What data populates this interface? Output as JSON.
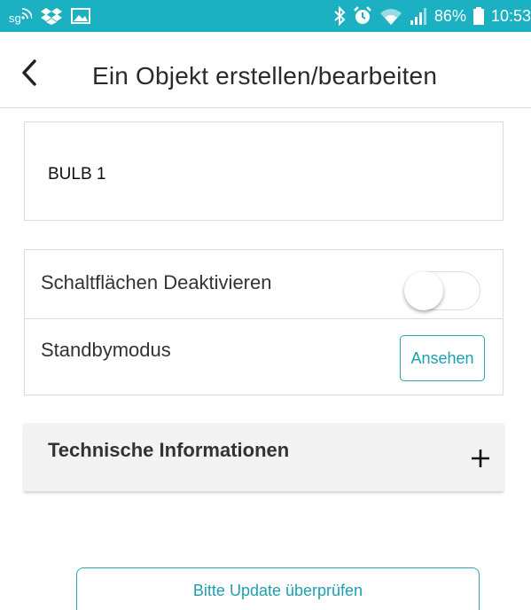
{
  "status_bar": {
    "left_icons": [
      "signal-sg-icon",
      "dropbox-icon",
      "image-icon"
    ],
    "right_icons": [
      "bluetooth-icon",
      "alarm-icon",
      "wifi-icon",
      "cell-signal-icon",
      "battery-icon"
    ],
    "battery": "86%",
    "time": "10:53",
    "background_color": "#1bb0c2"
  },
  "app_bar": {
    "back_icon": "chevron-left-icon",
    "title": "Ein Objekt erstellen/bearbeiten"
  },
  "device": {
    "name": "BULB 1"
  },
  "settings": {
    "disable_buttons_label": "Schaltflächen Deaktivieren",
    "disable_buttons_enabled": false,
    "standby_label": "Standbymodus",
    "standby_button": "Ansehen"
  },
  "technical_info": {
    "label": "Technische Informationen",
    "expand_icon": "plus-icon"
  },
  "update": {
    "button_label": "Bitte Update überprüfen"
  },
  "colors": {
    "accent": "#1e9fb0",
    "status_bar": "#1bb0c2"
  }
}
